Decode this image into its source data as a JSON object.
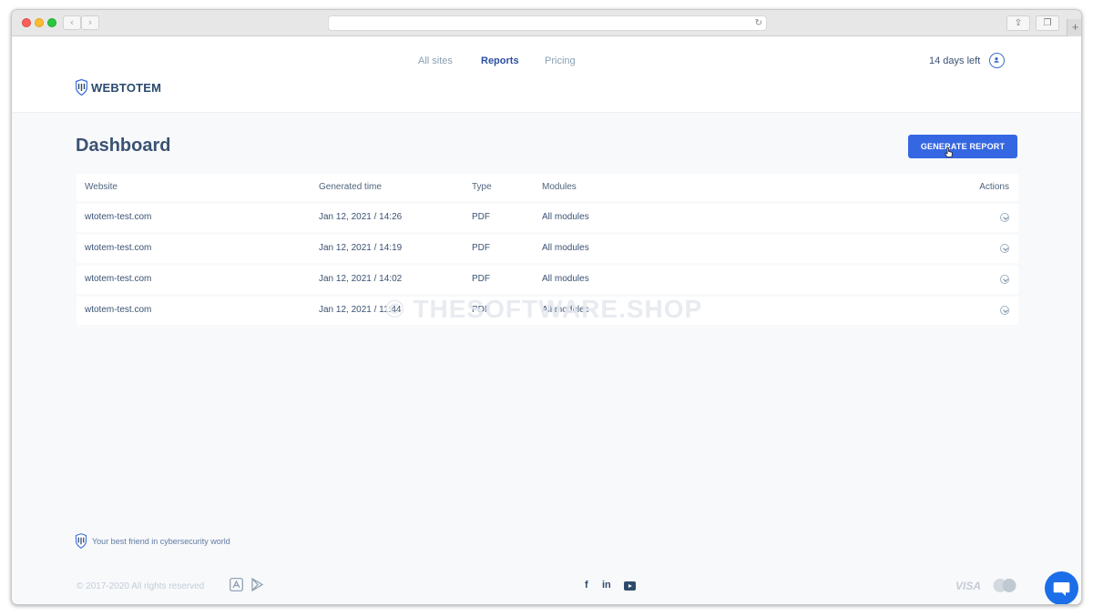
{
  "brand": {
    "name": "WEBTOTEM",
    "tagline": "Your best friend in cybersecurity world"
  },
  "nav": {
    "all_sites": "All sites",
    "reports": "Reports",
    "pricing": "Pricing"
  },
  "header": {
    "trial": "14 days left"
  },
  "page": {
    "title": "Dashboard",
    "generate_label": "GENERATE REPORT"
  },
  "table": {
    "columns": {
      "website": "Website",
      "time": "Generated time",
      "type": "Type",
      "modules": "Modules",
      "actions": "Actions"
    },
    "rows": [
      {
        "website": "wtotem-test.com",
        "time": "Jan 12, 2021 / 14:26",
        "type": "PDF",
        "modules": "All modules"
      },
      {
        "website": "wtotem-test.com",
        "time": "Jan 12, 2021 / 14:19",
        "type": "PDF",
        "modules": "All modules"
      },
      {
        "website": "wtotem-test.com",
        "time": "Jan 12, 2021 / 14:02",
        "type": "PDF",
        "modules": "All modules"
      },
      {
        "website": "wtotem-test.com",
        "time": "Jan 12, 2021 / 11:44",
        "type": "PDF",
        "modules": "All modules"
      }
    ]
  },
  "watermark": "© THESOFTWARE.SHOP",
  "footer": {
    "copyright": "© 2017-2020 All rights reserved",
    "fb": "f",
    "li": "in",
    "visa": "VISA"
  },
  "colors": {
    "accent": "#3567e3",
    "brand": "#2a4a6e",
    "chat": "#1b6ee8"
  }
}
